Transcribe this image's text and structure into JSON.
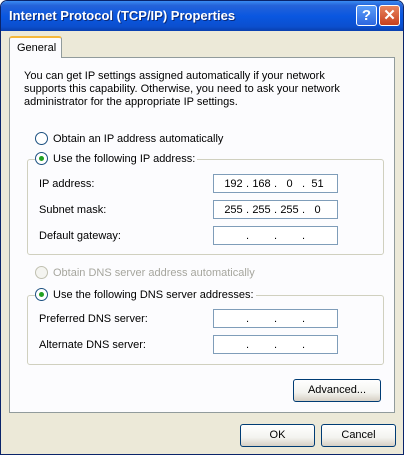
{
  "window": {
    "title": "Internet Protocol (TCP/IP) Properties",
    "help_glyph": "?",
    "close_glyph": "✕"
  },
  "tab": {
    "label": "General"
  },
  "description": "You can get IP settings assigned automatically if your network supports this capability. Otherwise, you need to ask your network administrator for the appropriate IP settings.",
  "ip": {
    "auto_label": "Obtain an IP address automatically",
    "manual_label": "Use the following IP address:",
    "selected": "manual",
    "fields": [
      {
        "label": "IP address:",
        "octets": [
          "192",
          "168",
          "0",
          "51"
        ]
      },
      {
        "label": "Subnet mask:",
        "octets": [
          "255",
          "255",
          "255",
          "0"
        ]
      },
      {
        "label": "Default gateway:",
        "octets": [
          "",
          "",
          "",
          ""
        ]
      }
    ]
  },
  "dns": {
    "auto_label": "Obtain DNS server address automatically",
    "auto_disabled": true,
    "manual_label": "Use the following DNS server addresses:",
    "selected": "manual",
    "fields": [
      {
        "label": "Preferred DNS server:",
        "octets": [
          "",
          "",
          "",
          ""
        ]
      },
      {
        "label": "Alternate DNS server:",
        "octets": [
          "",
          "",
          "",
          ""
        ]
      }
    ]
  },
  "buttons": {
    "advanced": "Advanced...",
    "ok": "OK",
    "cancel": "Cancel"
  },
  "separator": "."
}
